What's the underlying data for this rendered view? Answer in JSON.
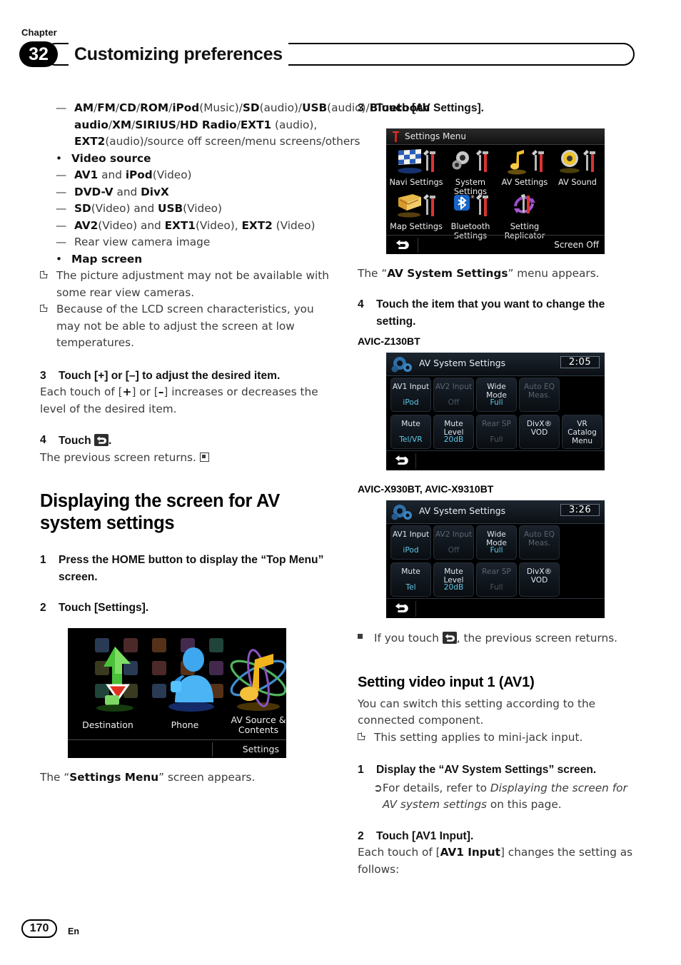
{
  "header": {
    "chapter_word": "Chapter",
    "chapter_number": "32",
    "title": "Customizing preferences"
  },
  "footer": {
    "page_number": "170",
    "language": "En"
  },
  "left_column": {
    "audio_source_dash": {
      "line1_a": "AM",
      "line1_sep": "/",
      "line1_b": "FM",
      "line1_c": "CD",
      "line1_d": "ROM",
      "line1_e": "iPod",
      "full_text_parts": [
        {
          "t": "AM",
          "b": true
        },
        {
          "t": "/",
          "b": false
        },
        {
          "t": "FM",
          "b": true
        },
        {
          "t": "/",
          "b": false
        },
        {
          "t": "CD",
          "b": true
        },
        {
          "t": "/",
          "b": false
        },
        {
          "t": "ROM",
          "b": true
        },
        {
          "t": "/",
          "b": false
        },
        {
          "t": "iPod",
          "b": true
        },
        {
          "t": "(Music)/",
          "b": false
        },
        {
          "t": "SD",
          "b": true
        },
        {
          "t": "(audio)/",
          "b": false
        },
        {
          "t": "USB",
          "b": true
        },
        {
          "t": "(audio)/",
          "b": false
        },
        {
          "t": "Bluetooth audio",
          "b": true
        },
        {
          "t": "/",
          "b": false
        },
        {
          "t": "XM",
          "b": true
        },
        {
          "t": "/",
          "b": false
        },
        {
          "t": "SIRIUS",
          "b": true
        },
        {
          "t": "/",
          "b": false
        },
        {
          "t": "HD Radio",
          "b": true
        },
        {
          "t": "/",
          "b": false
        },
        {
          "t": "EXT1",
          "b": true
        },
        {
          "t": " (audio), ",
          "b": false
        },
        {
          "t": "EXT2",
          "b": true
        },
        {
          "t": "(audio)/source off screen/menu screens/others",
          "b": false
        }
      ]
    },
    "video_source_heading": "Video source",
    "video_items": [
      [
        {
          "t": "AV1",
          "b": true
        },
        {
          "t": " and ",
          "b": false
        },
        {
          "t": "iPod",
          "b": true
        },
        {
          "t": "(Video)",
          "b": false
        }
      ],
      [
        {
          "t": "DVD-V",
          "b": true
        },
        {
          "t": " and ",
          "b": false
        },
        {
          "t": "DivX",
          "b": true
        }
      ],
      [
        {
          "t": "SD",
          "b": true
        },
        {
          "t": "(Video) and ",
          "b": false
        },
        {
          "t": "USB",
          "b": true
        },
        {
          "t": "(Video)",
          "b": false
        }
      ],
      [
        {
          "t": "AV2",
          "b": true
        },
        {
          "t": "(Video) and ",
          "b": false
        },
        {
          "t": "EXT1",
          "b": true
        },
        {
          "t": "(Video), ",
          "b": false
        },
        {
          "t": "EXT2",
          "b": true
        },
        {
          "t": " (Video)",
          "b": false
        }
      ],
      [
        {
          "t": "Rear view camera image",
          "b": false
        }
      ]
    ],
    "map_screen_heading": "Map screen",
    "notes": [
      "The picture adjustment may not be available with some rear view cameras.",
      "Because of the LCD screen characteristics, you may not be able to adjust the screen at low temperatures."
    ],
    "step3": {
      "number": "3",
      "title": "Touch [+] or [–] to adjust the desired item.",
      "body_parts": [
        {
          "t": "Each touch of [",
          "b": false
        },
        {
          "t": "+",
          "b": true
        },
        {
          "t": "] or [",
          "b": false
        },
        {
          "t": "–",
          "b": true
        },
        {
          "t": "] increases or decreases the level of the desired item.",
          "b": false
        }
      ]
    },
    "step4": {
      "number": "4",
      "title_prefix": "Touch ",
      "title_suffix": ".",
      "icon": "return-icon",
      "body": "The previous screen returns."
    },
    "section_heading": "Displaying the screen for AV system settings",
    "step1": {
      "number": "1",
      "title": "Press the HOME button to display the “Top Menu” screen."
    },
    "step2": {
      "number": "2",
      "title": "Touch [Settings]."
    },
    "top_menu_screenshot": {
      "alt": "Top Menu screen",
      "labels": [
        "Destination",
        "Phone",
        "AV Source & Contents"
      ],
      "av_source_line1": "AV Source &",
      "av_source_line2": "Contents",
      "settings_button": "Settings"
    },
    "caption_parts": [
      {
        "t": "The “",
        "b": false
      },
      {
        "t": "Settings Menu",
        "b": true
      },
      {
        "t": "” screen appears.",
        "b": false
      }
    ]
  },
  "right_column": {
    "step3": {
      "number": "3",
      "title": "Touch [AV Settings]."
    },
    "settings_menu_screenshot": {
      "title": "Settings Menu",
      "items": [
        {
          "line1": "Navi Settings",
          "line2": "",
          "icon": "checkered-flag-icon"
        },
        {
          "line1": "System",
          "line2": "Settings",
          "icon": "gears-icon"
        },
        {
          "line1": "AV Settings",
          "line2": "",
          "icon": "music-note-icon"
        },
        {
          "line1": "AV Sound",
          "line2": "",
          "icon": "speaker-icon"
        },
        {
          "line1": "Map Settings",
          "line2": "",
          "icon": "map-icon"
        },
        {
          "line1": "Bluetooth",
          "line2": "Settings",
          "icon": "bluetooth-icon"
        },
        {
          "line1": "Setting",
          "line2": "Replicator",
          "icon": "replicator-icon"
        }
      ],
      "screen_off": "Screen Off"
    },
    "caption1_parts": [
      {
        "t": "The “",
        "b": false
      },
      {
        "t": "AV System Settings",
        "b": true
      },
      {
        "t": "” menu appears.",
        "b": false
      }
    ],
    "step4": {
      "number": "4",
      "title": "Touch the item that you want to change the setting."
    },
    "model_label_1": "AVIC-Z130BT",
    "av_screenshot_1": {
      "title": "AV System Settings",
      "clock": "2:05",
      "buttons": [
        {
          "label": "AV1 Input",
          "value": "iPod",
          "dim": false
        },
        {
          "label": "AV2 Input",
          "value": "Off",
          "dim": true
        },
        {
          "label": "Wide Mode",
          "value": "Full",
          "dim": false
        },
        {
          "label": "Auto EQ Meas.",
          "value": "",
          "dim": true
        },
        {
          "label": "",
          "value": "",
          "blank": true
        },
        {
          "label": "Mute",
          "value": "Tel/VR",
          "dim": false
        },
        {
          "label": "Mute Level",
          "value": "20dB",
          "dim": false
        },
        {
          "label": "Rear SP",
          "value": "Full",
          "dim": true
        },
        {
          "label": "DivX® VOD",
          "value": "",
          "dim": false
        },
        {
          "label": "VR Catalog Menu",
          "value": "",
          "dim": false
        }
      ]
    },
    "model_label_2": "AVIC-X930BT, AVIC-X9310BT",
    "av_screenshot_2": {
      "title": "AV System Settings",
      "clock": "3:26",
      "buttons": [
        {
          "label": "AV1 Input",
          "value": "iPod",
          "dim": false
        },
        {
          "label": "AV2 Input",
          "value": "Off",
          "dim": true
        },
        {
          "label": "Wide Mode",
          "value": "Full",
          "dim": false
        },
        {
          "label": "Auto EQ Meas.",
          "value": "",
          "dim": true
        },
        {
          "label": "",
          "value": "",
          "blank": true
        },
        {
          "label": "Mute",
          "value": "Tel",
          "dim": false
        },
        {
          "label": "Mute Level",
          "value": "20dB",
          "dim": false
        },
        {
          "label": "Rear SP",
          "value": "Full",
          "dim": true
        },
        {
          "label": "DivX® VOD",
          "value": "",
          "dim": false
        },
        {
          "label": "",
          "value": "",
          "blank": true
        }
      ]
    },
    "bullet_note": {
      "prefix": "If you touch ",
      "suffix": ", the previous screen returns.",
      "icon": "return-icon"
    },
    "subsection_heading": "Setting video input 1 (AV1)",
    "subsection_body": "You can switch this setting according to the connected component.",
    "subsection_note": "This setting applies to mini-jack input.",
    "step1": {
      "number": "1",
      "title": "Display the “AV System Settings” screen.",
      "ref_parts": [
        {
          "t": "For details, refer to ",
          "i": false
        },
        {
          "t": "Displaying the screen for AV system settings",
          "i": true
        },
        {
          "t": " on this page.",
          "i": false
        }
      ]
    },
    "step2": {
      "number": "2",
      "title": "Touch [AV1 Input].",
      "body_parts": [
        {
          "t": "Each touch of [",
          "b": false
        },
        {
          "t": "AV1 Input",
          "b": true
        },
        {
          "t": "] changes the setting as follows:",
          "b": false
        }
      ]
    }
  },
  "colors": {
    "accent_cyan": "#5fc8e8",
    "screen_bg": "#000000",
    "text_gray": "#3c3c3c"
  }
}
